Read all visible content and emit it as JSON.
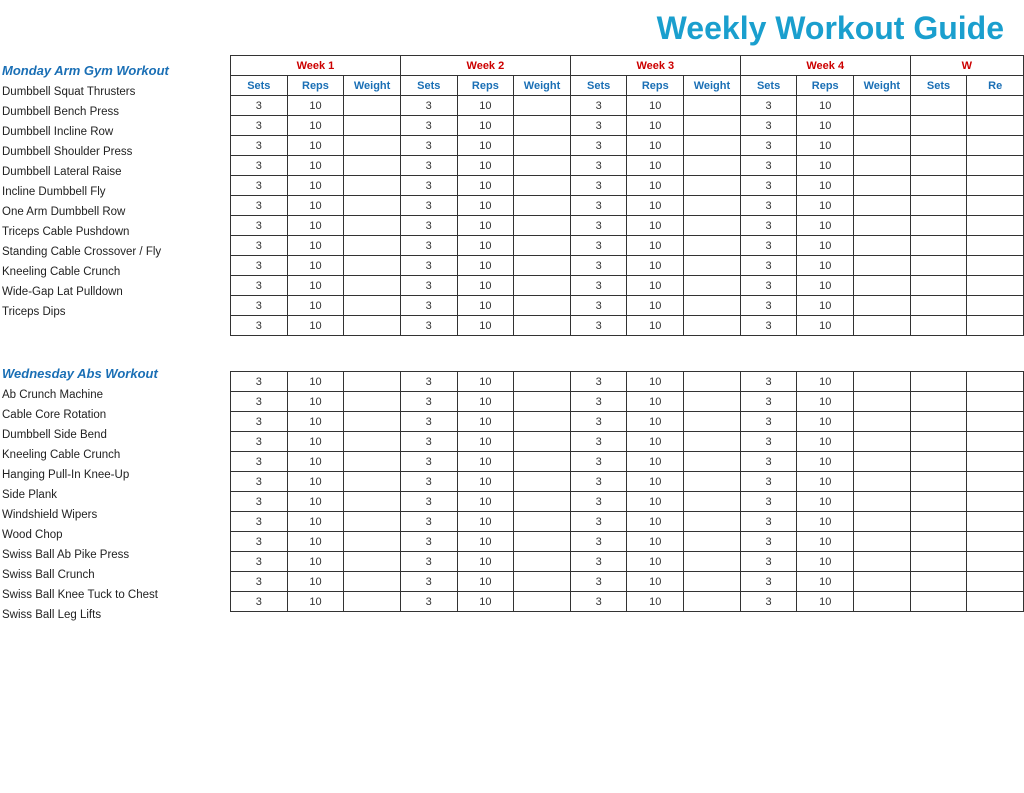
{
  "header": {
    "title": "Weekly Workout Guide"
  },
  "sections": [
    {
      "id": "monday",
      "title": "Monday Arm Gym Workout",
      "exercises": [
        "Dumbbell Squat Thrusters",
        "Dumbbell Bench Press",
        "Dumbbell Incline Row",
        "Dumbbell Shoulder Press",
        "Dumbbell Lateral Raise",
        "Incline Dumbbell Fly",
        "One Arm Dumbbell Row",
        "Triceps Cable Pushdown",
        "Standing Cable Crossover / Fly",
        "Kneeling Cable Crunch",
        "Wide-Gap Lat Pulldown",
        "Triceps Dips"
      ],
      "sets": 3,
      "reps": 10
    },
    {
      "id": "wednesday",
      "title": "Wednesday Abs Workout",
      "exercises": [
        "Ab Crunch Machine",
        "Cable Core Rotation",
        "Dumbbell Side Bend",
        "Kneeling Cable Crunch",
        "Hanging Pull-In Knee-Up",
        "Side Plank",
        "Windshield Wipers",
        "Wood Chop",
        "Swiss Ball Ab Pike Press",
        "Swiss Ball Crunch",
        "Swiss Ball Knee Tuck to Chest",
        "Swiss Ball Leg Lifts"
      ],
      "sets": 3,
      "reps": 10
    }
  ],
  "weeks": [
    "Week 1",
    "Week 2",
    "Week 3",
    "Week 4",
    "W"
  ],
  "col_labels": {
    "sets": "Sets",
    "reps": "Reps",
    "weight": "Weight"
  }
}
